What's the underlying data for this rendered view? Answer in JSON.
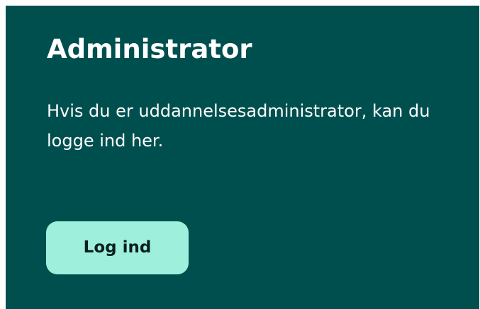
{
  "card": {
    "title": "Administrator",
    "description": "Hvis du er uddannelsesadministrator, kan du logge ind her.",
    "login_button_label": "Log ind"
  },
  "colors": {
    "card_background": "#004f4f",
    "text": "#ffffff",
    "button_background": "#9ef0dc",
    "button_text": "#0a1f1f"
  }
}
